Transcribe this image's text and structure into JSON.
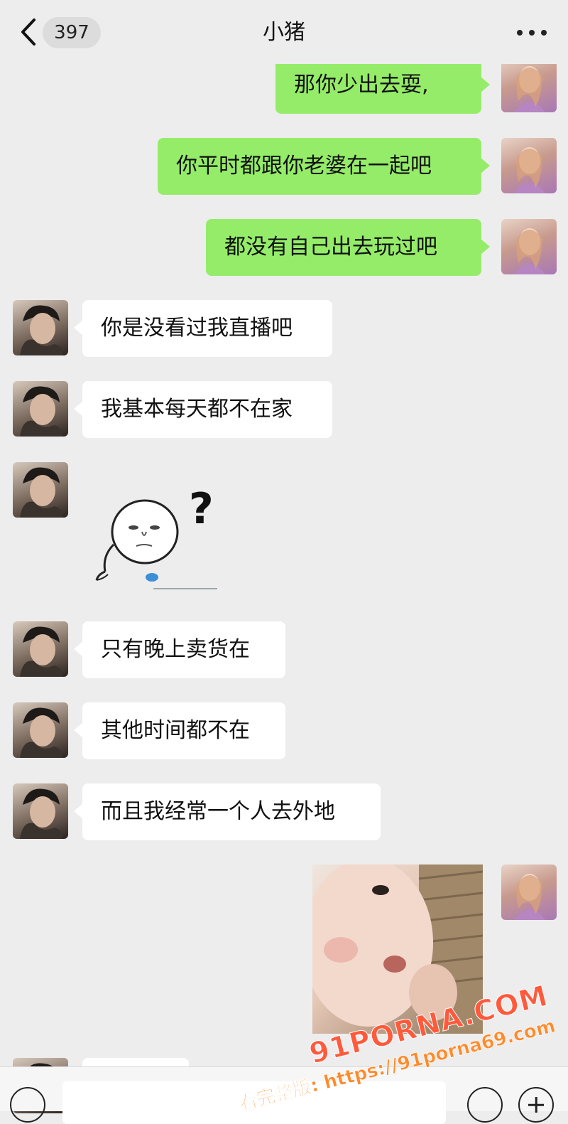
{
  "header": {
    "unread_count": "397",
    "title": "小猪"
  },
  "messages": [
    {
      "from": "me",
      "text": "那你少出去耍,"
    },
    {
      "from": "me",
      "text": "你平时都跟你老婆在一起吧"
    },
    {
      "from": "me",
      "text": "都没有自己出去玩过吧"
    },
    {
      "from": "them",
      "text": "你是没看过我直播吧"
    },
    {
      "from": "them",
      "text": "我基本每天都不在家"
    },
    {
      "from": "them",
      "type": "sticker",
      "sticker_text": "?"
    },
    {
      "from": "them",
      "text": "只有晚上卖货在"
    },
    {
      "from": "them",
      "text": "其他时间都不在"
    },
    {
      "from": "them",
      "text": "而且我经常一个人去外地"
    },
    {
      "from": "me",
      "type": "photo"
    }
  ],
  "watermark": {
    "logo": "91PORNA.COM",
    "subtitle": "看完整版: https://91porna69.com"
  },
  "colors": {
    "background": "#ededed",
    "my_bubble": "#95ec69",
    "their_bubble": "#ffffff"
  }
}
